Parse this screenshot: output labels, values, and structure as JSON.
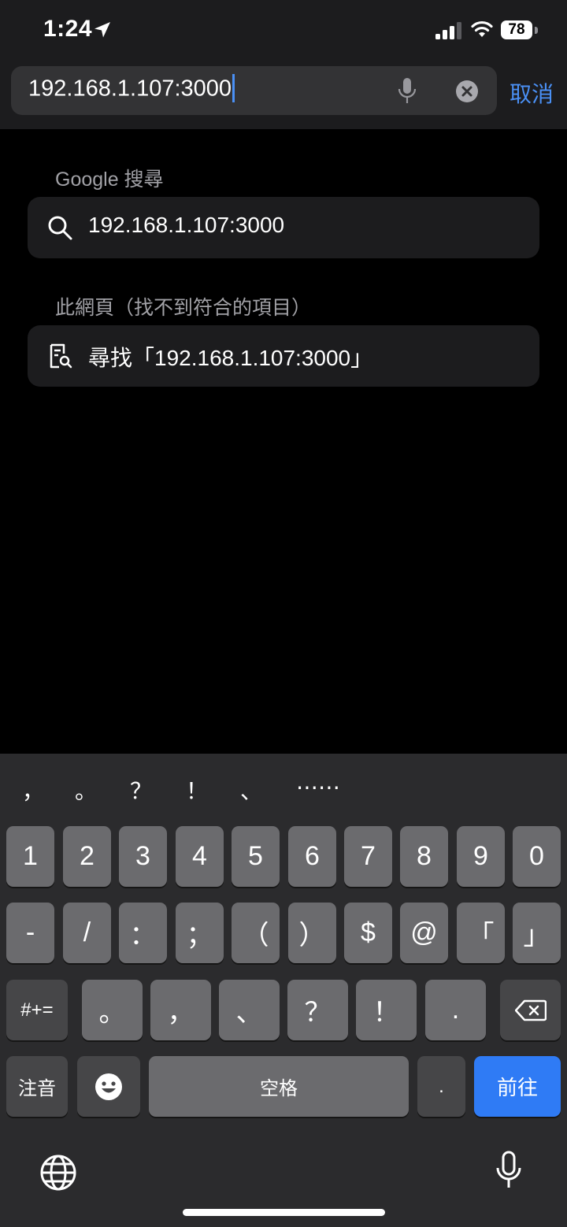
{
  "status_bar": {
    "time": "1:24",
    "battery": "78"
  },
  "address_bar": {
    "url_text": "192.168.1.107:3000",
    "cancel_label": "取消"
  },
  "google_section": {
    "title": "Google 搜尋",
    "query": "192.168.1.107:3000"
  },
  "page_section": {
    "title": "此網頁（找不到符合的項目）",
    "find_text": "尋找「192.168.1.107:3000」"
  },
  "keyboard": {
    "suggestions": [
      "，",
      "。",
      "？",
      "！",
      "、",
      "⋯⋯"
    ],
    "row1": [
      "1",
      "2",
      "3",
      "4",
      "5",
      "6",
      "7",
      "8",
      "9",
      "0"
    ],
    "row2": [
      "-",
      "/",
      "：",
      "；",
      "（",
      "）",
      "$",
      "@",
      "「",
      "」"
    ],
    "row3": [
      "。",
      "，",
      "、",
      "？",
      "！",
      "."
    ],
    "symbols_key": "#+=",
    "zhuyin_key": "注音",
    "space_key": "空格",
    "period_key": ".",
    "go_key": "前往"
  }
}
